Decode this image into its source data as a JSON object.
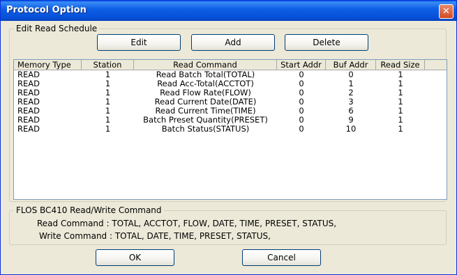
{
  "window": {
    "title": "Protocol Option",
    "close_glyph": "✕"
  },
  "schedule": {
    "group_label": "Edit Read Schedule",
    "buttons": {
      "edit": "Edit",
      "add": "Add",
      "delete": "Delete"
    },
    "columns": [
      "Memory Type",
      "Station",
      "Read Command",
      "Start Addr",
      "Buf Addr",
      "Read Size"
    ],
    "rows": [
      [
        "READ",
        "1",
        "Read Batch Total(TOTAL)",
        "0",
        "0",
        "1"
      ],
      [
        "READ",
        "1",
        "Read Acc-Total(ACCTOT)",
        "0",
        "1",
        "1"
      ],
      [
        "READ",
        "1",
        "Read Flow Rate(FLOW)",
        "0",
        "2",
        "1"
      ],
      [
        "READ",
        "1",
        "Read Current Date(DATE)",
        "0",
        "3",
        "1"
      ],
      [
        "READ",
        "1",
        "Read Current Time(TIME)",
        "0",
        "6",
        "1"
      ],
      [
        "READ",
        "1",
        "Batch Preset Quantity(PRESET)",
        "0",
        "9",
        "1"
      ],
      [
        "READ",
        "1",
        "Batch Status(STATUS)",
        "0",
        "10",
        "1"
      ]
    ]
  },
  "info": {
    "group_label": "FLOS BC410 Read/Write Command",
    "read_line": "Read Command : TOTAL, ACCTOT, FLOW, DATE, TIME, PRESET, STATUS,",
    "write_line": "Write Command : TOTAL, DATE, TIME, PRESET, STATUS,"
  },
  "footer": {
    "ok": "OK",
    "cancel": "Cancel"
  },
  "colors": {
    "title_bar": "#0650d8",
    "close": "#d24b25",
    "dialog_bg": "#ece9d8"
  }
}
